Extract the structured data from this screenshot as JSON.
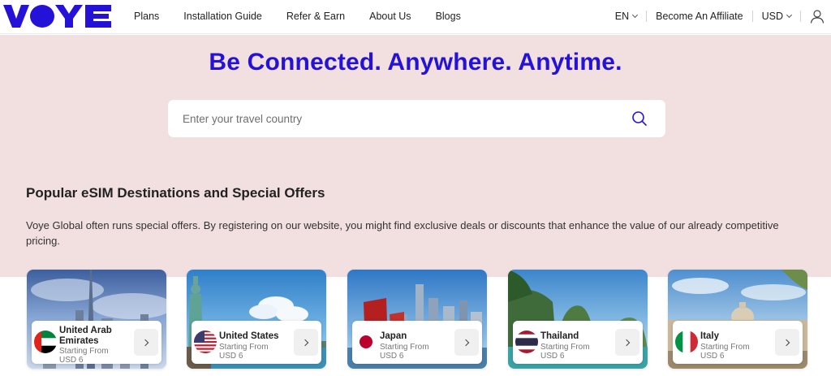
{
  "brand": {
    "logo_text": "VOYE",
    "color": "#2412d9"
  },
  "nav": {
    "items": [
      {
        "label": "Plans"
      },
      {
        "label": "Installation Guide"
      },
      {
        "label": "Refer & Earn"
      },
      {
        "label": "About Us"
      },
      {
        "label": "Blogs"
      }
    ],
    "language": "EN",
    "affiliate": "Become An Affiliate",
    "currency": "USD",
    "user_icon": "user-icon"
  },
  "hero": {
    "title": "Be Connected. Anywhere. Anytime.",
    "search_placeholder": "Enter your travel country",
    "search_icon": "search-icon",
    "background": "#f2dfe0"
  },
  "section": {
    "title": "Popular eSIM Destinations and Special Offers",
    "description": "Voye Global often runs special offers. By registering on our website, you might find exclusive deals or discounts that enhance the value of our already competitive pricing."
  },
  "destinations": [
    {
      "name": "United Arab Emirates",
      "starting_label": "Starting From",
      "price": "USD 6",
      "flag": "uae-flag-icon"
    },
    {
      "name": "United States",
      "starting_label": "Starting From",
      "price": "USD 6",
      "flag": "us-flag-icon"
    },
    {
      "name": "Japan",
      "starting_label": "Starting From",
      "price": "USD 6",
      "flag": "japan-flag-icon"
    },
    {
      "name": "Thailand",
      "starting_label": "Starting From",
      "price": "USD 6",
      "flag": "thailand-flag-icon"
    },
    {
      "name": "Italy",
      "starting_label": "Starting From",
      "price": "USD 6",
      "flag": "italy-flag-icon"
    }
  ]
}
